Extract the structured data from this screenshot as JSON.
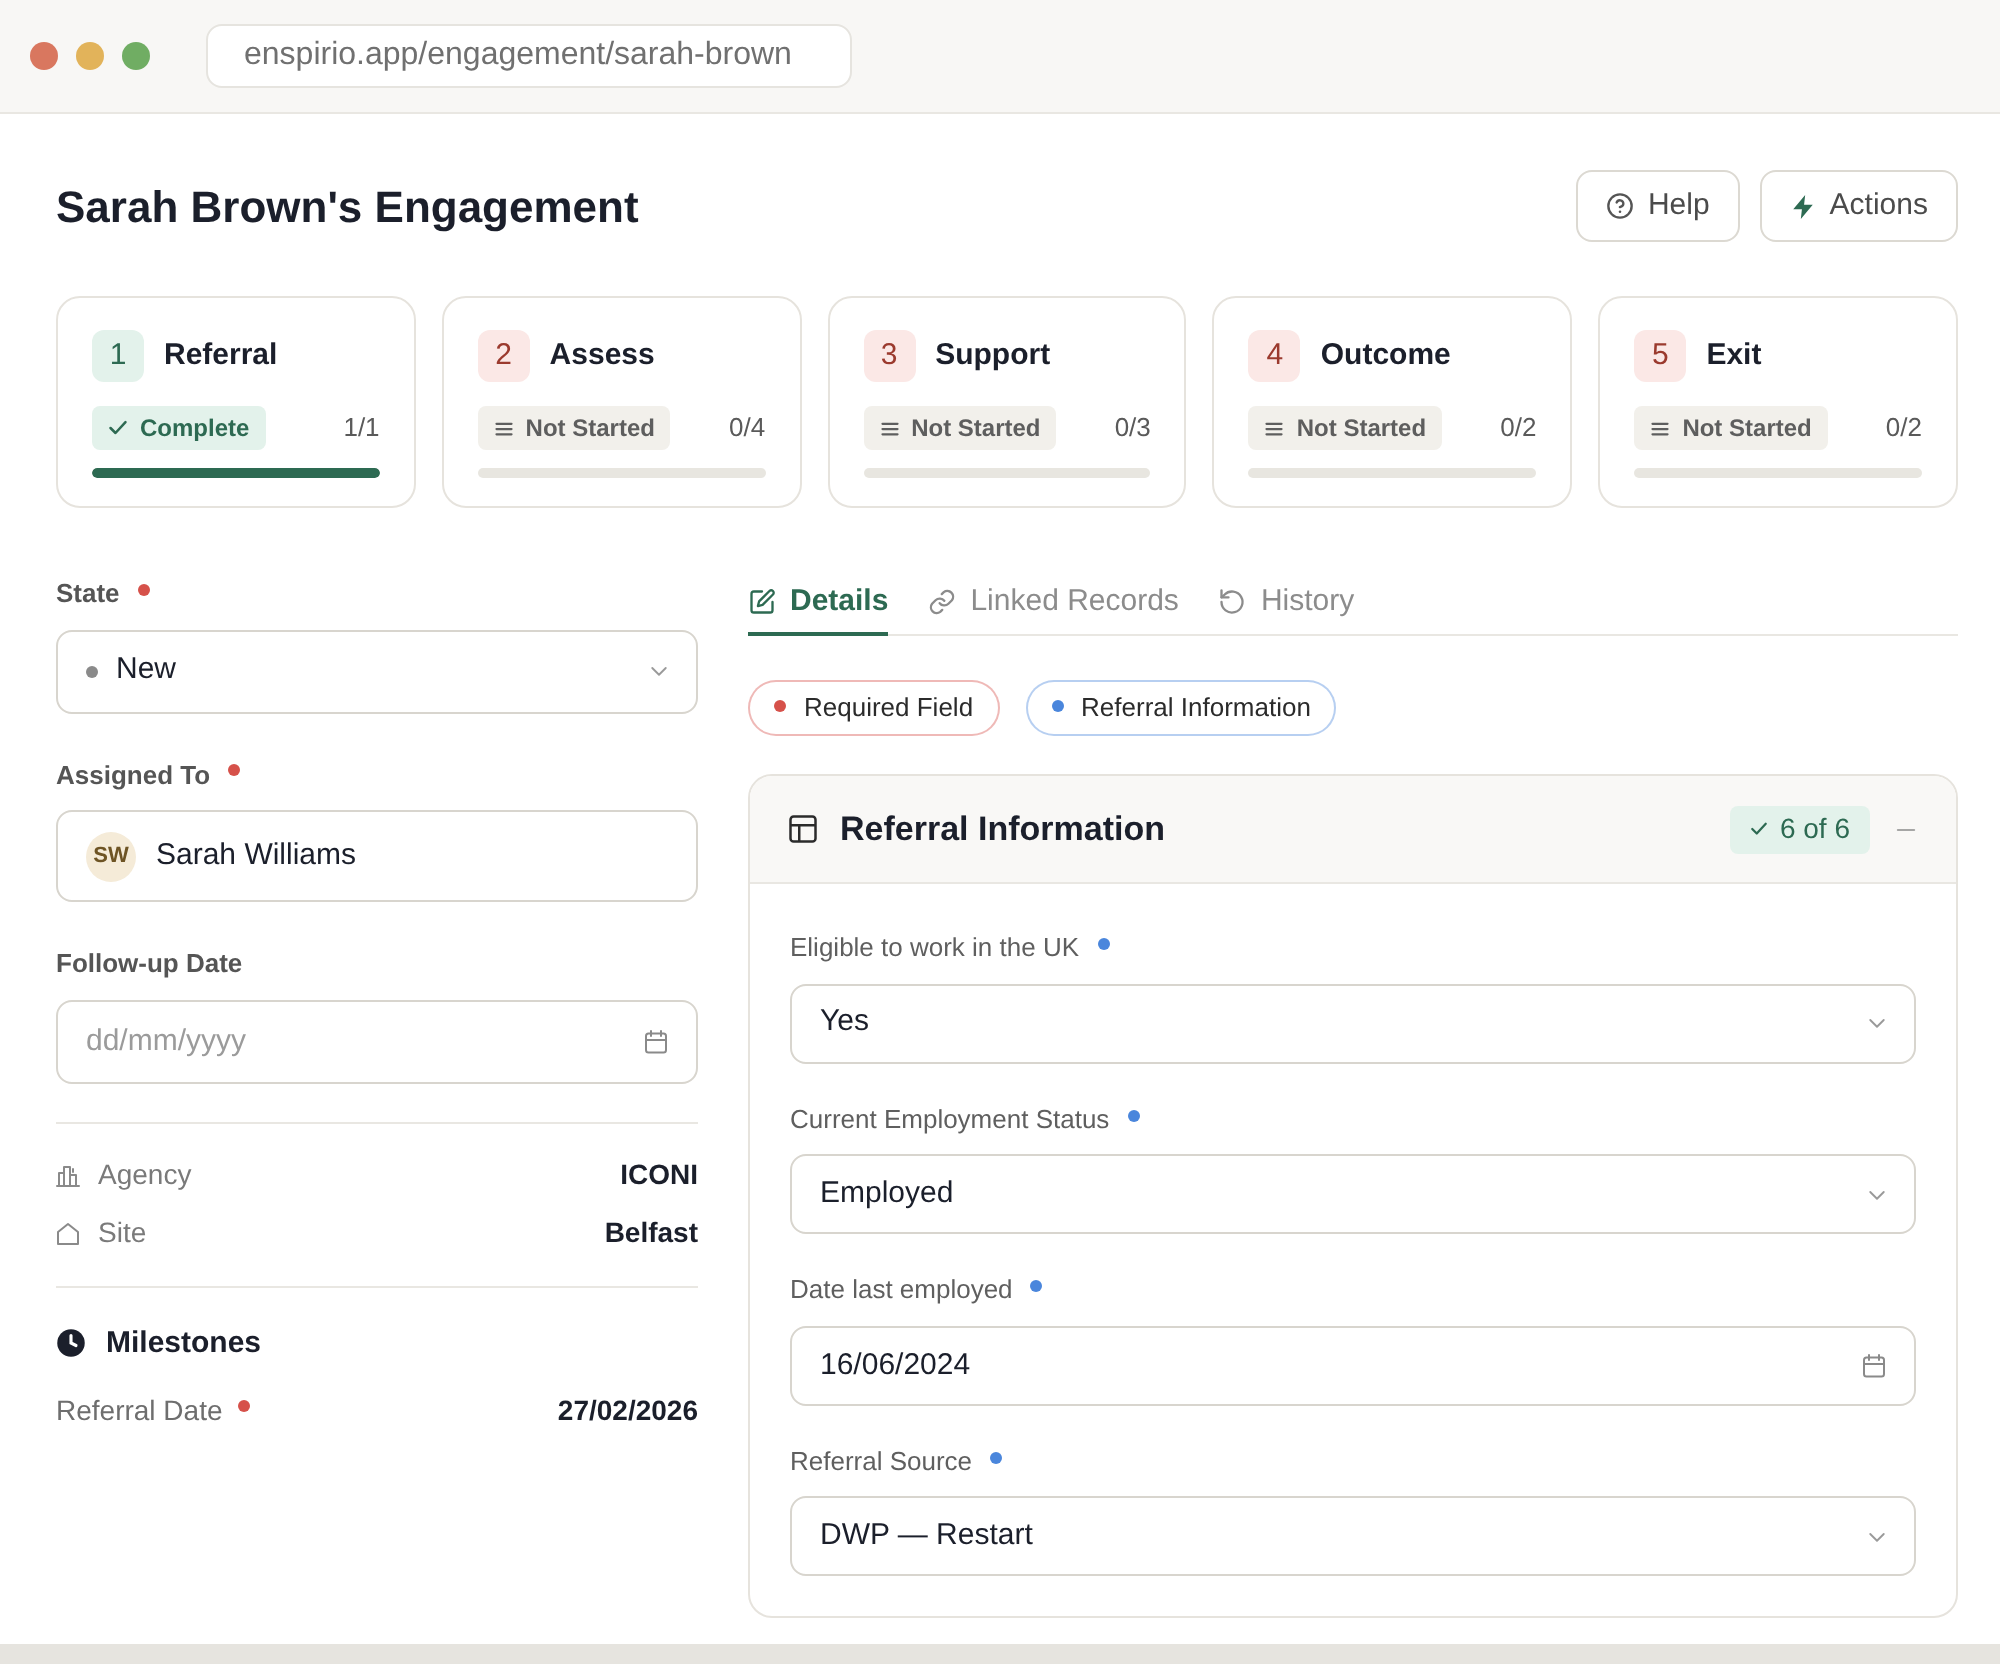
{
  "browser": {
    "url": "enspirio.app/engagement/sarah-brown"
  },
  "header": {
    "title": "Sarah Brown's Engagement",
    "buttons": [
      {
        "label": "Help",
        "kind": "help"
      },
      {
        "label": "Actions",
        "kind": "actions"
      }
    ]
  },
  "stages": [
    {
      "number": "1",
      "title": "Referral",
      "status": "Complete",
      "kind": "complete",
      "count": "1/1",
      "level": 1
    },
    {
      "number": "2",
      "title": "Assess",
      "status": "Not Started",
      "kind": "not_started",
      "count": "0/4",
      "level": 0
    },
    {
      "number": "3",
      "title": "Support",
      "status": "Not Started",
      "kind": "not_started",
      "count": "0/3",
      "level": 0
    },
    {
      "number": "4",
      "title": "Outcome",
      "status": "Not Started",
      "kind": "not_started",
      "count": "0/2",
      "level": 0
    },
    {
      "number": "5",
      "title": "Exit",
      "status": "Not Started",
      "kind": "not_started",
      "count": "0/2",
      "level": 0
    }
  ],
  "sidebar": {
    "fields": [
      {
        "label": "State",
        "required": true,
        "kind": "status",
        "value": "New"
      },
      {
        "label": "Assigned To",
        "required": true,
        "kind": "person",
        "initials": "SW",
        "value": "Sarah Williams"
      },
      {
        "label": "Follow-up Date",
        "required": false,
        "kind": "date",
        "placeholder": "dd/mm/yyyy"
      }
    ],
    "details": [
      {
        "label": "Agency",
        "value": "ICONI",
        "kind": "agency"
      },
      {
        "label": "Site",
        "value": "Belfast",
        "kind": "site"
      }
    ],
    "milestones": {
      "title": "Milestones",
      "items": [
        {
          "label": "Referral Date",
          "required": true,
          "value": "27/02/2026"
        }
      ]
    }
  },
  "tabs": [
    {
      "label": "Details",
      "kind": "details",
      "selected": true
    },
    {
      "label": "Linked Records",
      "kind": "links",
      "selected": false
    },
    {
      "label": "History",
      "kind": "history",
      "selected": false
    }
  ],
  "legend": [
    {
      "label": "Required Field",
      "color": "#d6514a"
    },
    {
      "label": "Referral Information",
      "color": "#4a86dc"
    }
  ],
  "section": {
    "title": "Referral Information",
    "badge": "6 of 6",
    "expanded": true,
    "fields": [
      {
        "label": "Eligible to work in the UK",
        "kind": "select",
        "value": "Yes"
      },
      {
        "label": "Current Employment Status",
        "kind": "select",
        "value": "Employed"
      },
      {
        "label": "Date last employed",
        "kind": "date",
        "value": "16/06/2024"
      },
      {
        "label": "Referral Source",
        "kind": "select",
        "value": "DWP — Restart"
      }
    ]
  }
}
